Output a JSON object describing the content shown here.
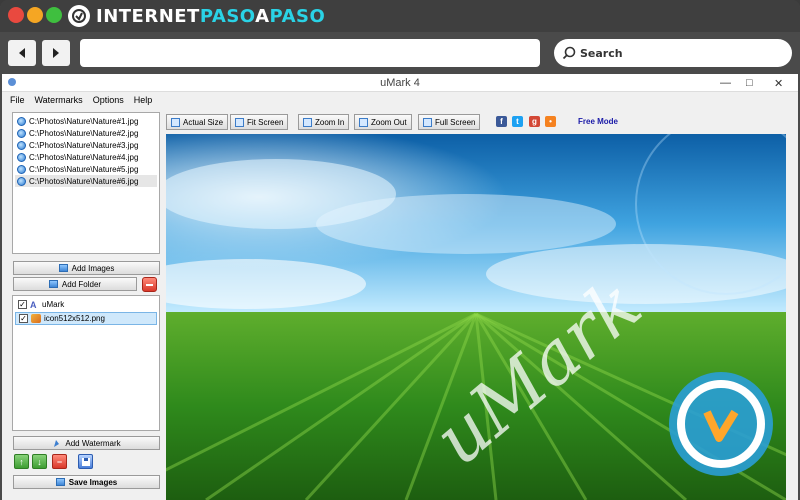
{
  "browser": {
    "brand": {
      "part1": "INTERNET",
      "part2": "PASO",
      "part3": "A",
      "part4": "PASO"
    },
    "search_placeholder": "Search"
  },
  "window": {
    "title": "uMark 4"
  },
  "menu": [
    "File",
    "Watermarks",
    "Options",
    "Help"
  ],
  "files": [
    "C:\\Photos\\Nature\\Nature#1.jpg",
    "C:\\Photos\\Nature\\Nature#2.jpg",
    "C:\\Photos\\Nature\\Nature#3.jpg",
    "C:\\Photos\\Nature\\Nature#4.jpg",
    "C:\\Photos\\Nature\\Nature#5.jpg",
    "C:\\Photos\\Nature\\Nature#6.jpg"
  ],
  "buttons": {
    "add_images": "Add Images",
    "add_folder": "Add Folder",
    "add_watermark": "Add Watermark",
    "save_images": "Save Images"
  },
  "watermarks": [
    {
      "label": "uMark",
      "checked": true
    },
    {
      "label": "icon512x512.png",
      "checked": true
    }
  ],
  "toolbar": {
    "actual_size": "Actual Size",
    "fit_screen": "Fit Screen",
    "zoom_in": "Zoom In",
    "zoom_out": "Zoom Out",
    "full_screen": "Full Screen",
    "mode": "Free Mode"
  },
  "preview": {
    "watermark_text": "uMark"
  },
  "colors": {
    "accent": "#2ad3e6",
    "mode_text": "#1a1aa8"
  },
  "icons": [
    "back-arrow-icon",
    "forward-arrow-icon",
    "search-icon",
    "facebook-icon",
    "twitter-icon",
    "google-plus-icon",
    "rss-icon"
  ]
}
